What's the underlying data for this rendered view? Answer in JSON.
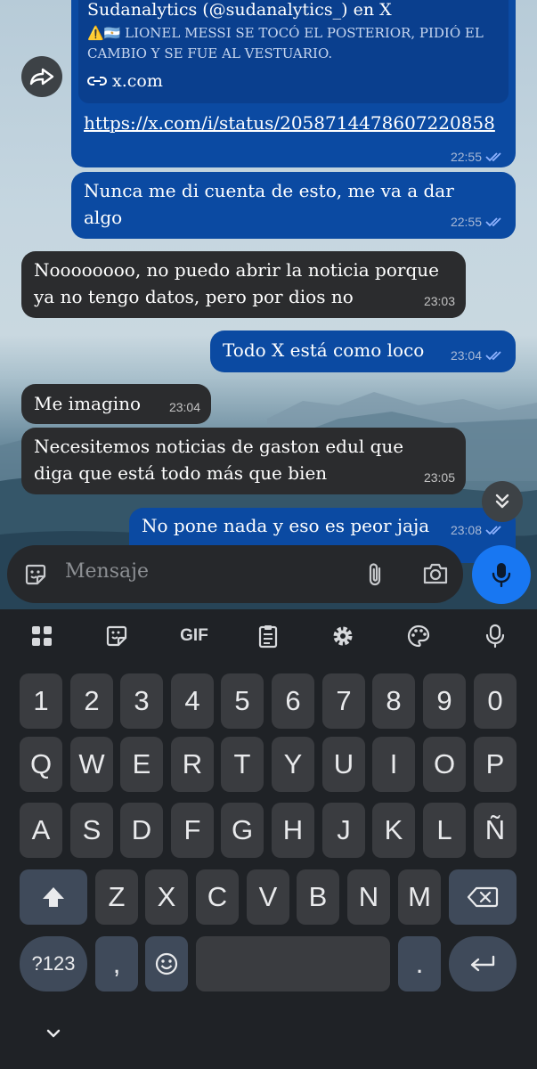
{
  "chat": {
    "link_preview": {
      "title": "Sudanalytics (@sudanalytics_) en X",
      "description": "⚠️🇦🇷 LIONEL MESSI SE TOCÓ EL POSTERIOR, PIDIÓ EL CAMBIO Y SE FUE AL VESTUARIO.",
      "site": "x.com",
      "url": "https://x.com/i/status/2058714478607220858",
      "time": "22:55"
    },
    "messages": [
      {
        "dir": "out",
        "text": "Nunca me di cuenta de esto, me va a dar algo",
        "time": "22:55"
      },
      {
        "dir": "in",
        "text": "Noooooooo, no puedo abrir la noticia porque ya no tengo datos, pero por dios no",
        "time": "23:03"
      },
      {
        "dir": "out",
        "text": "Todo X está como loco",
        "time": "23:04"
      },
      {
        "dir": "in",
        "text": "Me imagino",
        "time": "23:04"
      },
      {
        "dir": "in",
        "text": "Necesitemos noticias de gaston edul que diga que está todo más que bien",
        "time": "23:05"
      },
      {
        "dir": "out",
        "text": "No pone nada y eso es peor jaja",
        "time": "23:08"
      }
    ]
  },
  "composer": {
    "placeholder": "Mensaje",
    "icons": [
      "sticker-icon",
      "attach-icon",
      "camera-icon",
      "mic-icon"
    ]
  },
  "keyboard": {
    "toolbar": [
      "apps-icon",
      "sticker-icon",
      "GIF",
      "clipboard-icon",
      "settings-icon",
      "palette-icon",
      "mic-icon"
    ],
    "row_numbers": [
      "1",
      "2",
      "3",
      "4",
      "5",
      "6",
      "7",
      "8",
      "9",
      "0"
    ],
    "row_top": [
      "Q",
      "W",
      "E",
      "R",
      "T",
      "Y",
      "U",
      "I",
      "O",
      "P"
    ],
    "row_mid": [
      "A",
      "S",
      "D",
      "F",
      "G",
      "H",
      "J",
      "K",
      "L",
      "Ñ"
    ],
    "row_bottom": [
      "Z",
      "X",
      "C",
      "V",
      "B",
      "N",
      "M"
    ],
    "symbols_key": "?123",
    "comma": ",",
    "period": "."
  },
  "colors": {
    "outgoing_bubble": "#0b4aa2",
    "incoming_bubble": "#2b2c2e",
    "accent": "#1877f2",
    "keyboard_bg": "#1f2226"
  }
}
